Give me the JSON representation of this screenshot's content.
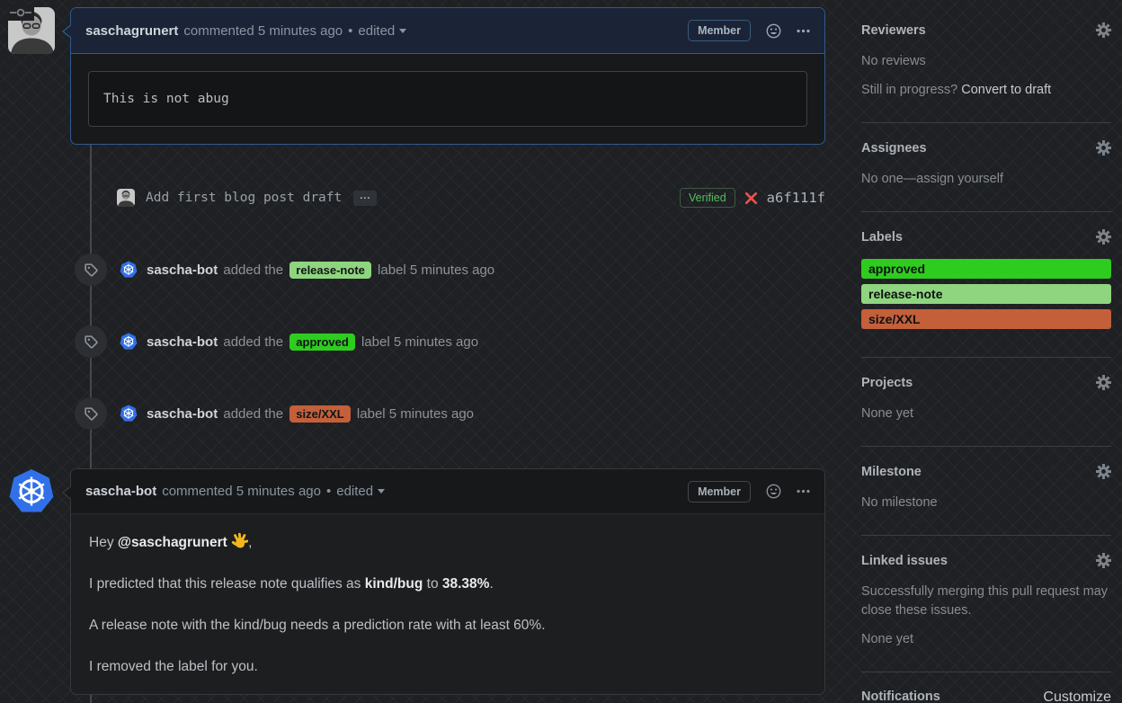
{
  "colors": {
    "k8s_blue": "#3170e8",
    "verified_green": "#4fc15c",
    "danger_red": "#e5534b"
  },
  "comments": [
    {
      "author": "saschagrunert",
      "meta": "commented 5 minutes ago",
      "separator": "•",
      "edited_label": "edited",
      "member_badge": "Member",
      "code_body": "This is not abug"
    },
    {
      "author": "sascha-bot",
      "meta": "commented 5 minutes ago",
      "separator": "•",
      "edited_label": "edited",
      "member_badge": "Member",
      "body": {
        "greeting_prefix": "Hey ",
        "mention": "@saschagrunert",
        "greeting_suffix": ",",
        "line2_prefix": "I predicted that this release note qualifies as ",
        "line2_bold1": "kind/bug",
        "line2_mid": " to ",
        "line2_bold2": "38.38%",
        "line2_suffix": ".",
        "line3": "A release note with the kind/bug needs a prediction rate with at least 60%.",
        "line4": "I removed the label for you."
      }
    }
  ],
  "commit": {
    "message": "Add first blog post draft",
    "expander": "...",
    "verified_badge": "Verified",
    "sha": "a6f111f"
  },
  "events": [
    {
      "actor": "sascha-bot",
      "action": "added the",
      "label": "release-note",
      "label_bg": "#8FD57F",
      "suffix": "label 5 minutes ago"
    },
    {
      "actor": "sascha-bot",
      "action": "added the",
      "label": "approved",
      "label_bg": "#2ECC1F",
      "suffix": "label 5 minutes ago"
    },
    {
      "actor": "sascha-bot",
      "action": "added the",
      "label": "size/XXL",
      "label_bg": "#C3603A",
      "suffix": "label 5 minutes ago"
    }
  ],
  "sidebar": {
    "reviewers": {
      "title": "Reviewers",
      "empty": "No reviews",
      "hint_prefix": "Still in progress?",
      "hint_link": "Convert to draft"
    },
    "assignees": {
      "title": "Assignees",
      "empty_prefix": "No one—",
      "empty_link": "assign yourself"
    },
    "labels": {
      "title": "Labels",
      "items": [
        {
          "name": "approved",
          "bg": "#2ECC1F"
        },
        {
          "name": "release-note",
          "bg": "#8FD57F"
        },
        {
          "name": "size/XXL",
          "bg": "#C3603A"
        }
      ]
    },
    "projects": {
      "title": "Projects",
      "empty": "None yet"
    },
    "milestone": {
      "title": "Milestone",
      "empty": "No milestone"
    },
    "linked_issues": {
      "title": "Linked issues",
      "description": "Successfully merging this pull request may close these issues.",
      "empty": "None yet"
    },
    "notifications": {
      "title": "Notifications",
      "action": "Customize"
    }
  }
}
